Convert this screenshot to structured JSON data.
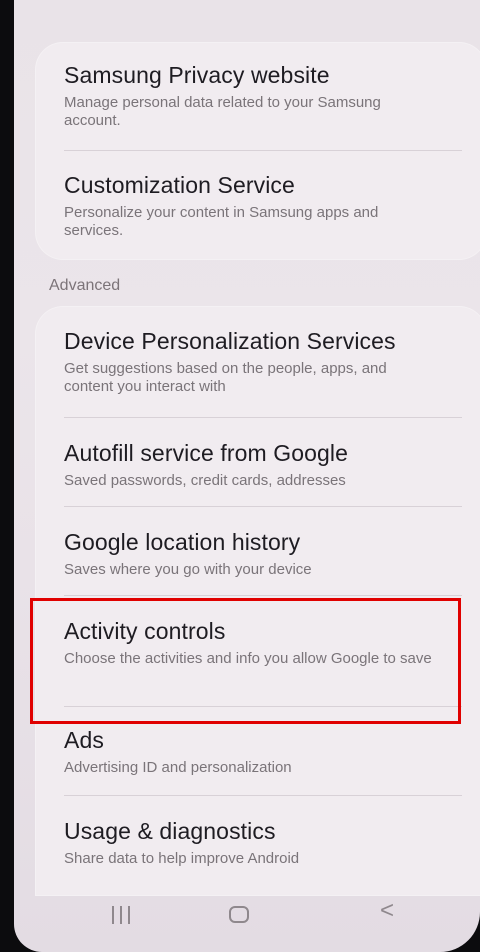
{
  "section_header": "Advanced",
  "card1": {
    "items": [
      {
        "title": "Samsung Privacy website",
        "desc": "Manage personal data related to your Samsung account."
      },
      {
        "title": "Customization Service",
        "desc": "Personalize your content in Samsung apps and services."
      }
    ]
  },
  "card2": {
    "items": [
      {
        "title": "Device Personalization Services",
        "desc": "Get suggestions based on the people, apps, and content you interact with"
      },
      {
        "title": "Autofill service from Google",
        "desc": "Saved passwords, credit cards, addresses"
      },
      {
        "title": "Google location history",
        "desc": "Saves where you go with your device"
      },
      {
        "title": "Activity controls",
        "desc": "Choose the activities and info you allow Google to save"
      },
      {
        "title": "Ads",
        "desc": "Advertising ID and personalization"
      },
      {
        "title": "Usage & diagnostics",
        "desc": "Share data to help improve Android"
      }
    ]
  },
  "navbar": {
    "recent_icon": "recent-apps-icon",
    "home_icon": "home-icon",
    "back_icon": "back-icon",
    "back_glyph": "<"
  },
  "colors": {
    "highlight": "#e00000",
    "background": "#ebe5ea"
  }
}
